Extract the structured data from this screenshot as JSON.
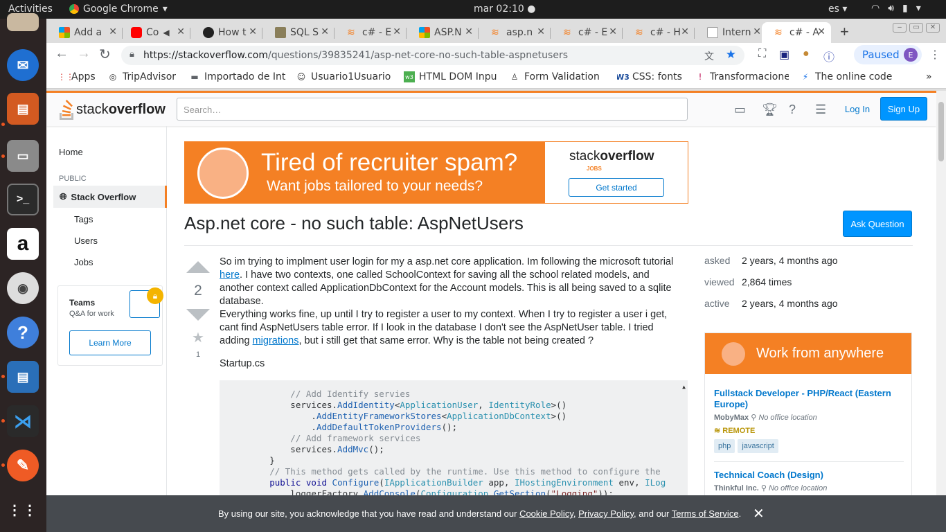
{
  "os": {
    "activities": "Activities",
    "app_name": "Google Chrome",
    "clock": "mar 02:10",
    "lang": "es"
  },
  "tabs": [
    {
      "label": "Add a"
    },
    {
      "label": "Co"
    },
    {
      "label": "How t"
    },
    {
      "label": "SQL S"
    },
    {
      "label": "c# - E"
    },
    {
      "label": "ASP.N"
    },
    {
      "label": "asp.n"
    },
    {
      "label": "c# - E"
    },
    {
      "label": "c# - H"
    },
    {
      "label": "Intern"
    },
    {
      "label": "c# - A"
    }
  ],
  "url": {
    "base": "https://stackoverflow.com",
    "path": "/questions/39835241/asp-net-core-no-such-table-aspnetusers"
  },
  "profile": {
    "status": "Paused",
    "initial": "E"
  },
  "bookmarks": [
    {
      "label": "Apps"
    },
    {
      "label": "TripAdvisor"
    },
    {
      "label": "Importado de Int"
    },
    {
      "label": "Usuario1Usuario"
    },
    {
      "label": "HTML DOM Inpu"
    },
    {
      "label": "Form Validation"
    },
    {
      "label": "CSS: fonts"
    },
    {
      "label": "Transformacione"
    },
    {
      "label": "The online code"
    }
  ],
  "so": {
    "logo_a": "stack",
    "logo_b": "overflow",
    "search_placeholder": "Search…",
    "login": "Log In",
    "signup": "Sign Up"
  },
  "leftnav": {
    "home": "Home",
    "public": "PUBLIC",
    "stackoverflow": "Stack Overflow",
    "tags": "Tags",
    "users": "Users",
    "jobs": "Jobs",
    "teams_title": "Teams",
    "teams_sub": "Q&A for work",
    "learn_more": "Learn More"
  },
  "banner": {
    "headline": "Tired of recruiter spam?",
    "sub": "Want jobs tailored to your needs?",
    "logo_a": "stack",
    "logo_b": "overflow",
    "jobs_tag": "JOBS",
    "cta": "Get started"
  },
  "question": {
    "title": "Asp.net core - no such table: AspNetUsers",
    "ask_button": "Ask Question",
    "votes": "2",
    "favorites": "1",
    "p1_a": "So im trying to implment user login for my a asp.net core application. Im following the microsoft tutorial ",
    "p1_link": "here",
    "p1_b": ". I have two contexts, one called SchoolContext for saving all the school related models, and another context called ApplicationDbContext for the Account models. This is all being saved to a sqlite database.",
    "p2_a": "Everything works fine, up until I try to register a user to my context. When I try to register a user i get, cant find AspNetUsers table error. If I look in the database I don't see the AspNetUser table. I tried adding ",
    "p2_link": "migrations",
    "p2_b": ", but i still get that same error. Why is the table not being created ?",
    "startup": "Startup.cs"
  },
  "meta": {
    "asked_label": "asked",
    "asked": "2 years, 4 months ago",
    "viewed_label": "viewed",
    "viewed": "2,864 times",
    "active_label": "active",
    "active": "2 years, 4 months ago"
  },
  "jobs_widget": {
    "header": "Work from anywhere",
    "job1_title": "Fullstack Developer - PHP/React (Eastern Europe)",
    "job1_company": "MobyMax",
    "job1_location": "No office location",
    "job1_remote": "REMOTE",
    "job1_tags": [
      "php",
      "javascript"
    ],
    "job2_title": "Technical Coach (Design)",
    "job2_company": "Thinkful Inc.",
    "job2_location": "No office location"
  },
  "cookie": {
    "text_a": "By using our site, you acknowledge that you have read and understand our ",
    "cookie_policy": "Cookie Policy",
    "sep1": ", ",
    "privacy_policy": "Privacy Policy",
    "sep2": ", and our ",
    "terms": "Terms of Service",
    "end": "."
  },
  "colors": {
    "so_orange": "#f48024",
    "so_blue": "#0095ff",
    "link": "#0077cc"
  }
}
